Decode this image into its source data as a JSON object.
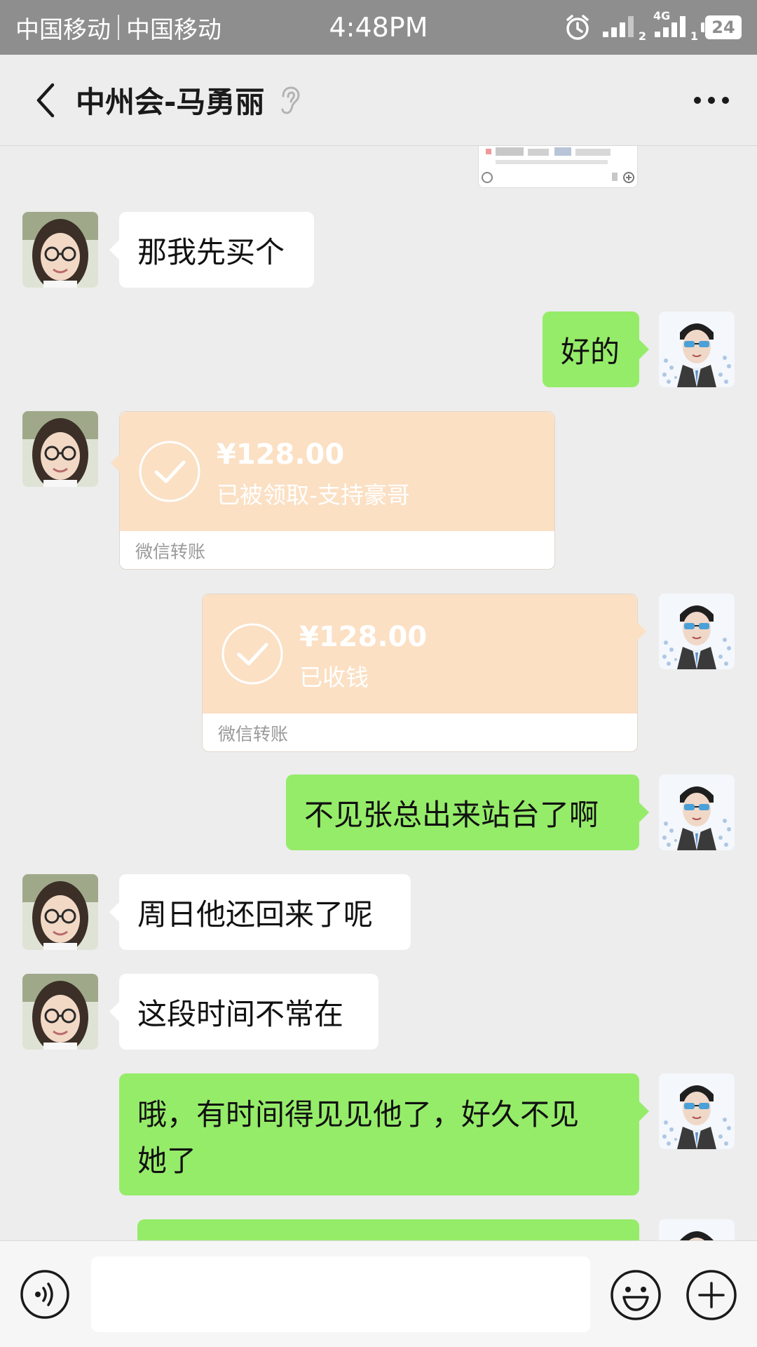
{
  "status_bar": {
    "carrier1": "中国移动",
    "carrier2": "中国移动",
    "time": "4:48PM",
    "network_label": "4G",
    "sim1_label": "2",
    "sim2_label": "1",
    "battery": "24"
  },
  "nav": {
    "title": "中州会-马勇丽"
  },
  "messages": [
    {
      "side": "left",
      "text": "那我先买个"
    },
    {
      "side": "right",
      "text": "好的"
    },
    {
      "side": "left",
      "type": "transfer",
      "amount": "¥128.00",
      "note": "已被领取-支持豪哥",
      "footer": "微信转账"
    },
    {
      "side": "right",
      "type": "transfer",
      "amount": "¥128.00",
      "note": "已收钱",
      "footer": "微信转账"
    },
    {
      "side": "right",
      "text": "不见张总出来站台了啊"
    },
    {
      "side": "left",
      "text": "周日他还回来了呢"
    },
    {
      "side": "left",
      "text": "这段时间不常在"
    },
    {
      "side": "right",
      "text_line1": "哦，有时间得见见他了，好久不见",
      "text_line2": "她了"
    }
  ],
  "input": {
    "value": ""
  },
  "colors": {
    "status_bar": "#8e8e8e",
    "chat_bg": "#ededed",
    "green_bubble": "#95ec69",
    "white_bubble": "#ffffff",
    "transfer_card": "#fbe0c4"
  }
}
